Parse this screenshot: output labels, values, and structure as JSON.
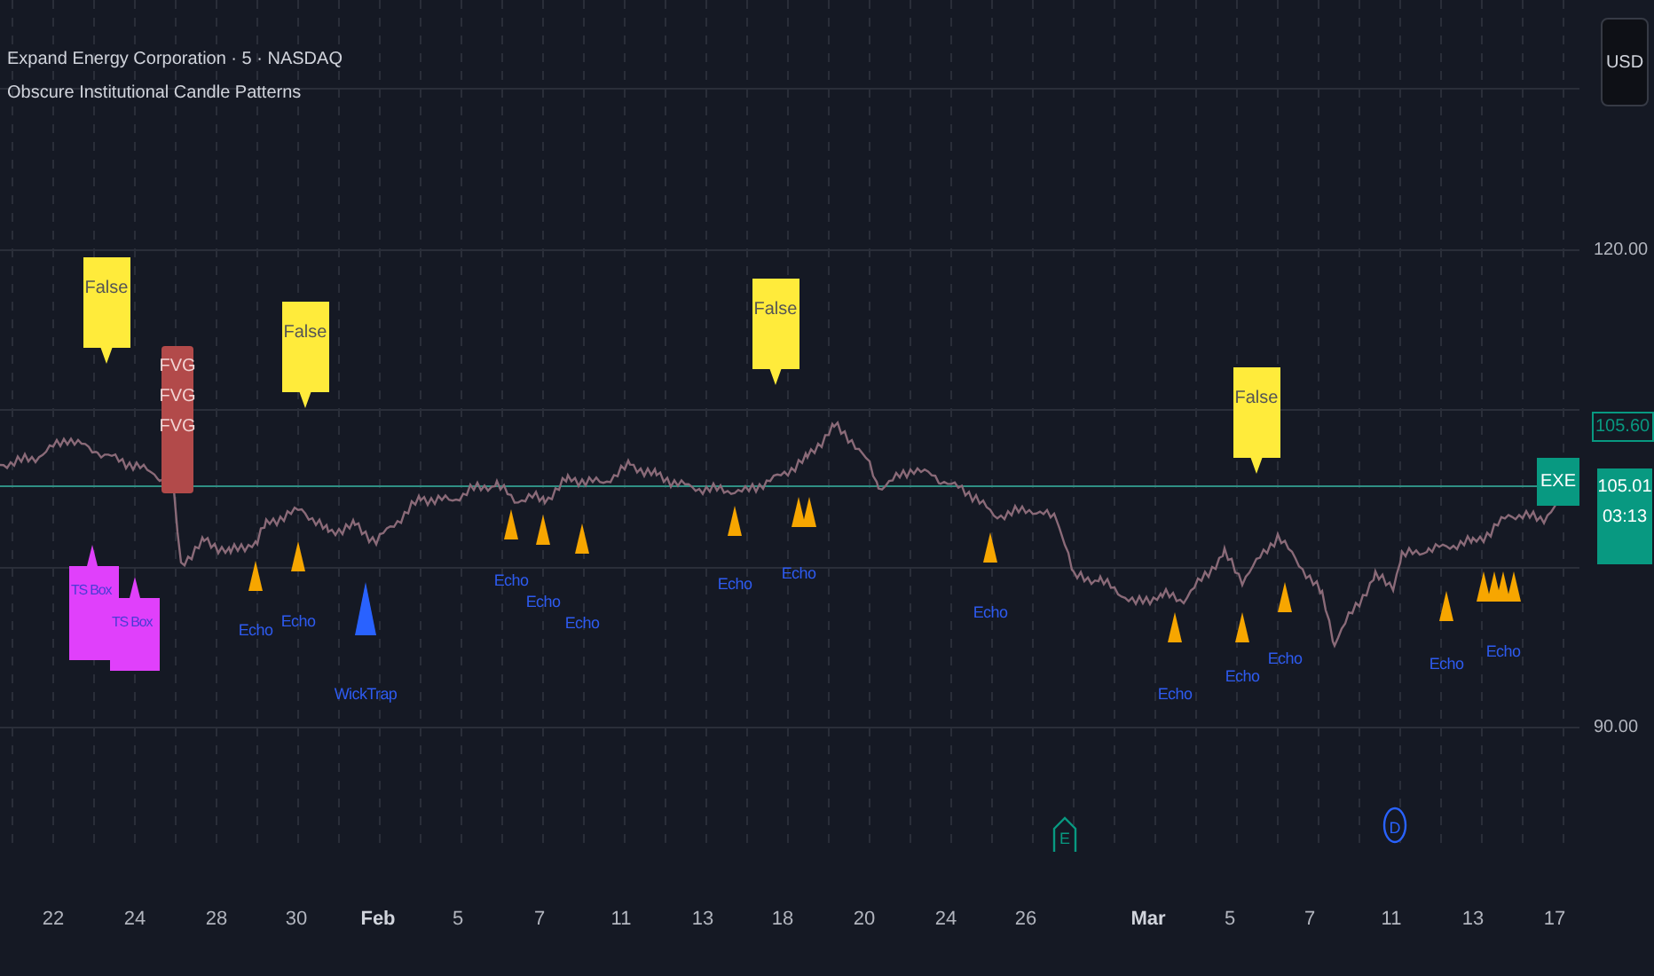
{
  "legend": {
    "title": "Expand Energy Corporation · 5 · NASDAQ",
    "indicator": "Obscure Institutional Candle Patterns"
  },
  "markers": [
    {
      "kind": "callout",
      "label": "False"
    },
    {
      "kind": "ts_box",
      "label": "TS Box"
    },
    {
      "kind": "ts_box",
      "label": "TS Box"
    },
    {
      "kind": "fvg",
      "labels": [
        "FVG",
        "FVG",
        "FVG"
      ]
    },
    {
      "kind": "echo",
      "label": "Echo"
    },
    {
      "kind": "callout",
      "label": "False"
    },
    {
      "kind": "echo",
      "label": "Echo"
    },
    {
      "kind": "wicktrap",
      "label": "WickTrap"
    },
    {
      "kind": "echo",
      "label": "Echo"
    },
    {
      "kind": "echo",
      "label": "Echo"
    },
    {
      "kind": "echo",
      "label": "Echo"
    },
    {
      "kind": "echo",
      "label": "Echo"
    },
    {
      "kind": "callout",
      "label": "False"
    },
    {
      "kind": "echo",
      "label": "Echo"
    },
    {
      "kind": "echo"
    },
    {
      "kind": "echo",
      "label": "Echo"
    },
    {
      "kind": "event",
      "label": "E",
      "color": "#089981"
    },
    {
      "kind": "echo",
      "label": "Echo"
    },
    {
      "kind": "echo",
      "label": "Echo"
    },
    {
      "kind": "callout",
      "label": "False"
    },
    {
      "kind": "echo",
      "label": "Echo"
    },
    {
      "kind": "event",
      "label": "D",
      "color": "#2962ff"
    },
    {
      "kind": "echo",
      "label": "Echo"
    },
    {
      "kind": "echo"
    },
    {
      "kind": "echo"
    },
    {
      "kind": "echo",
      "label": "Echo"
    },
    {
      "kind": "echo"
    }
  ],
  "price_axis": {
    "currency": "USD",
    "ticks": [
      "120.00",
      "90.00"
    ],
    "high_label": "105.60",
    "symbol": "EXE",
    "last_price": "105.01",
    "countdown": "03:13"
  },
  "time_axis": {
    "labels": [
      {
        "text": "22",
        "kind": "day"
      },
      {
        "text": "24",
        "kind": "day"
      },
      {
        "text": "28",
        "kind": "day"
      },
      {
        "text": "30",
        "kind": "day"
      },
      {
        "text": "Feb",
        "kind": "month"
      },
      {
        "text": "5",
        "kind": "day"
      },
      {
        "text": "7",
        "kind": "day"
      },
      {
        "text": "11",
        "kind": "day"
      },
      {
        "text": "13",
        "kind": "day"
      },
      {
        "text": "18",
        "kind": "day"
      },
      {
        "text": "20",
        "kind": "day"
      },
      {
        "text": "24",
        "kind": "day"
      },
      {
        "text": "26",
        "kind": "day"
      },
      {
        "text": "Mar",
        "kind": "month"
      },
      {
        "text": "5",
        "kind": "day"
      },
      {
        "text": "7",
        "kind": "day"
      },
      {
        "text": "11",
        "kind": "day"
      },
      {
        "text": "13",
        "kind": "day"
      },
      {
        "text": "17",
        "kind": "day"
      }
    ]
  }
}
